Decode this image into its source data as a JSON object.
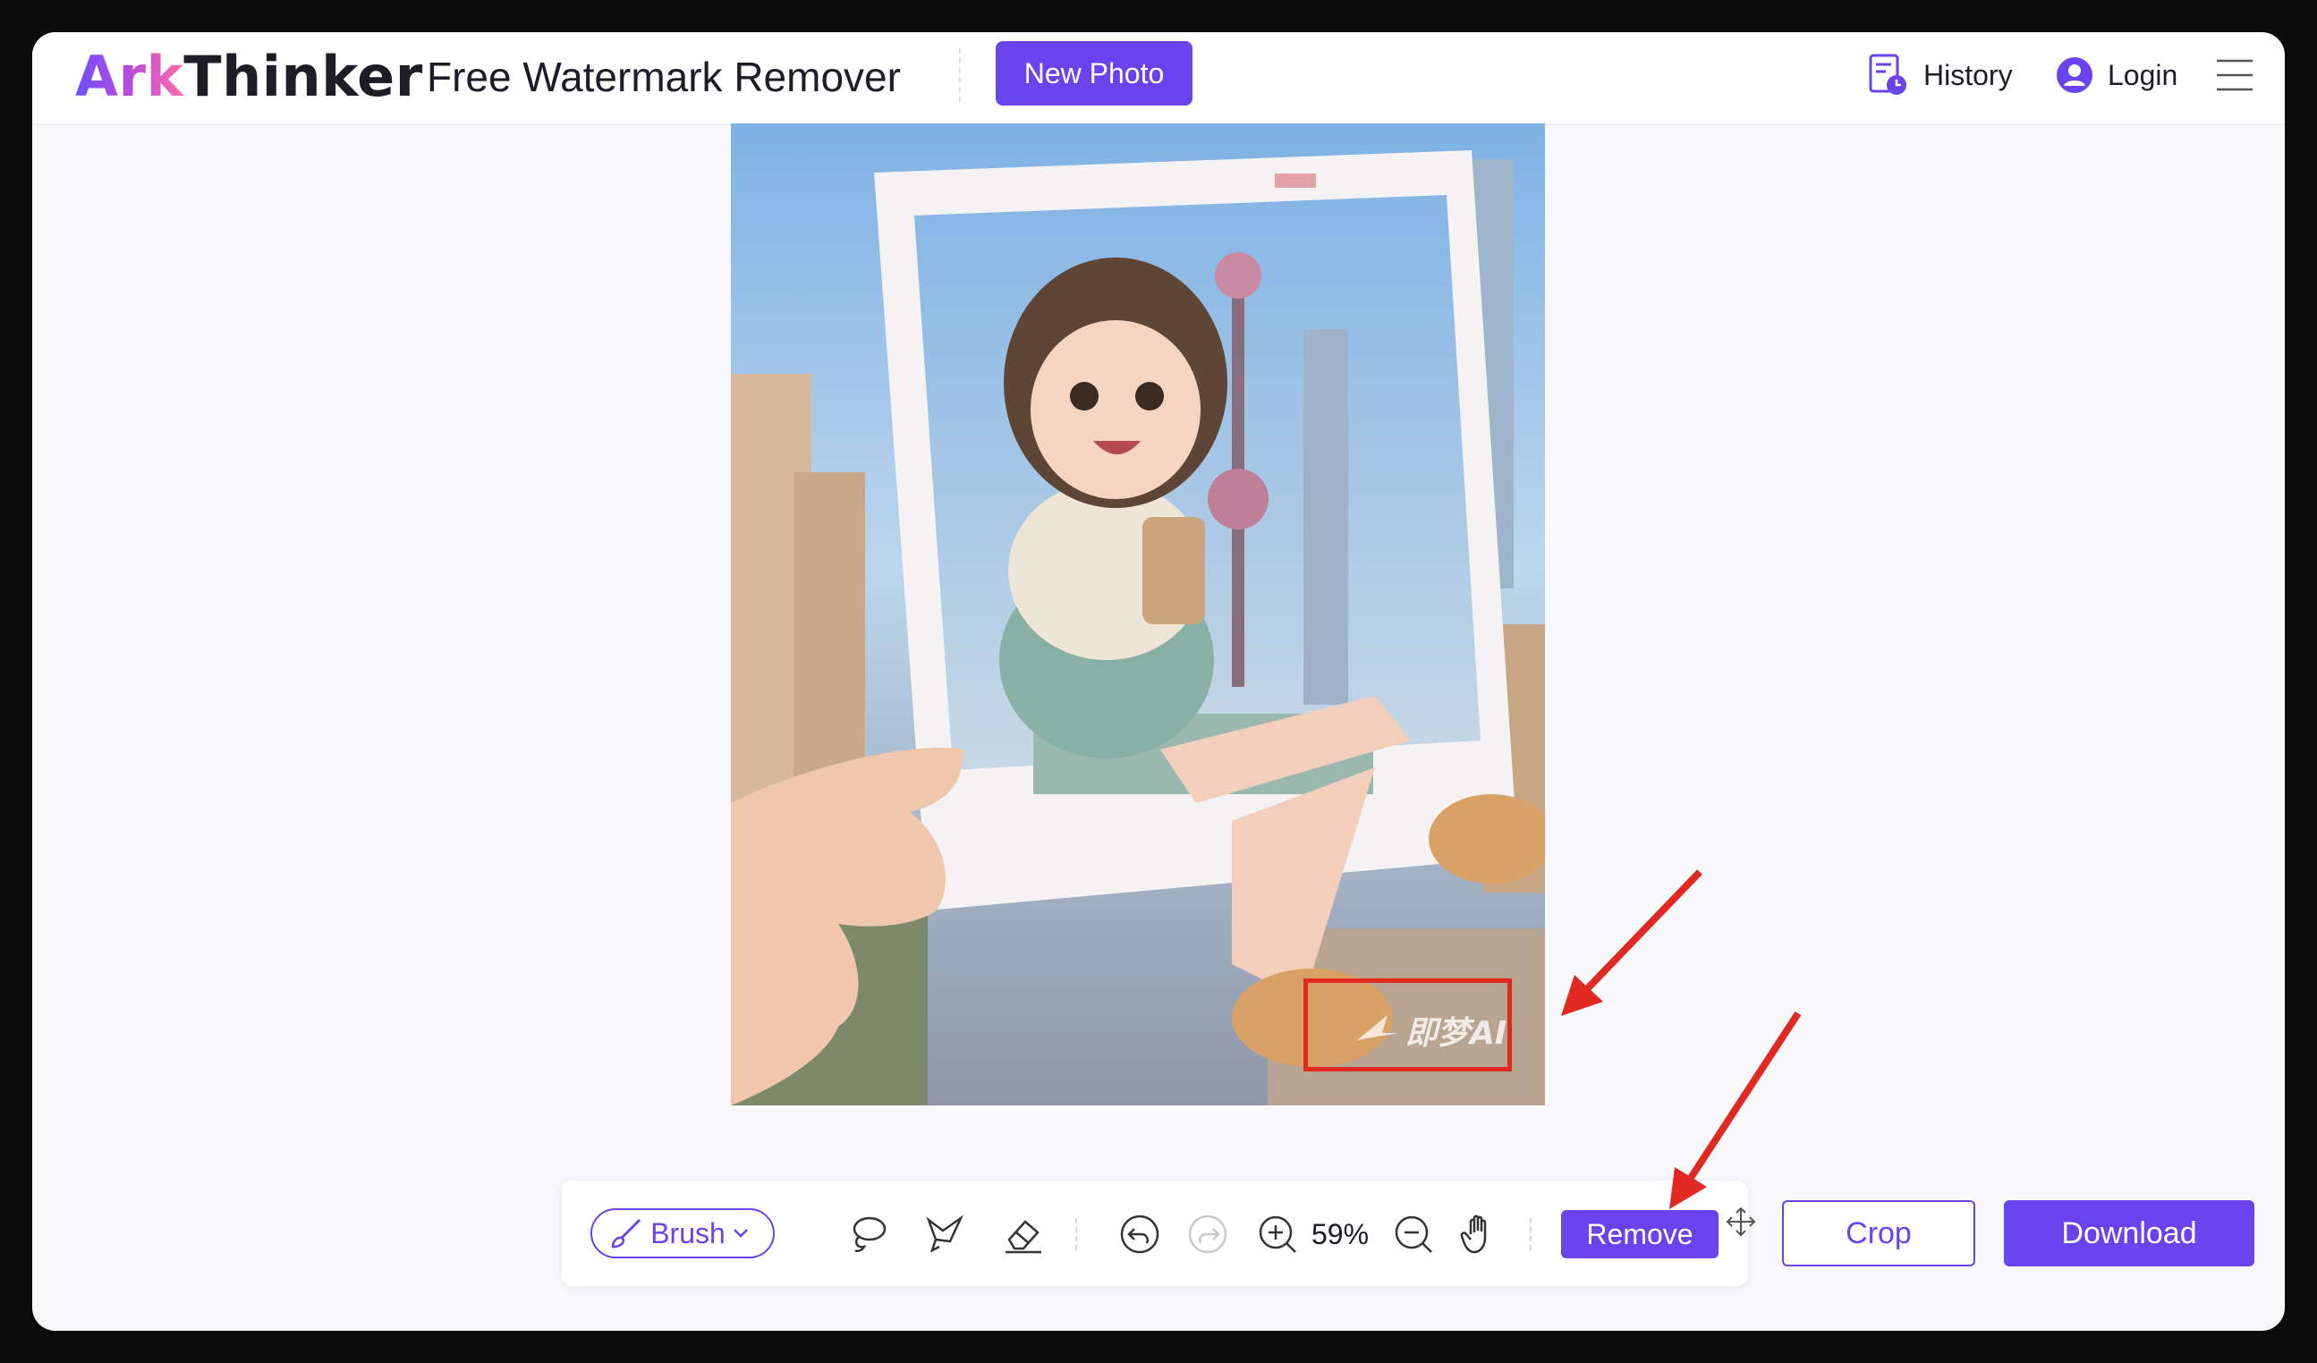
{
  "header": {
    "logo_ark": "Ark",
    "logo_thinker": "Thinker",
    "app_title": "Free Watermark Remover",
    "new_photo_label": "New Photo",
    "history_label": "History",
    "login_label": "Login"
  },
  "image": {
    "watermark_text": "即梦AI"
  },
  "toolbar": {
    "brush_label": "Brush",
    "zoom_level": "59%",
    "remove_label": "Remove",
    "crop_label": "Crop",
    "download_label": "Download"
  },
  "colors": {
    "accent": "#6a43ee",
    "highlight": "#e02a21"
  },
  "icons": [
    "history-icon",
    "user-icon",
    "hamburger-menu-icon",
    "brush-icon",
    "lasso-icon",
    "polygon-lasso-icon",
    "eraser-icon",
    "undo-icon",
    "redo-icon",
    "zoom-in-icon",
    "zoom-out-icon",
    "hand-pan-icon",
    "move-icon"
  ]
}
